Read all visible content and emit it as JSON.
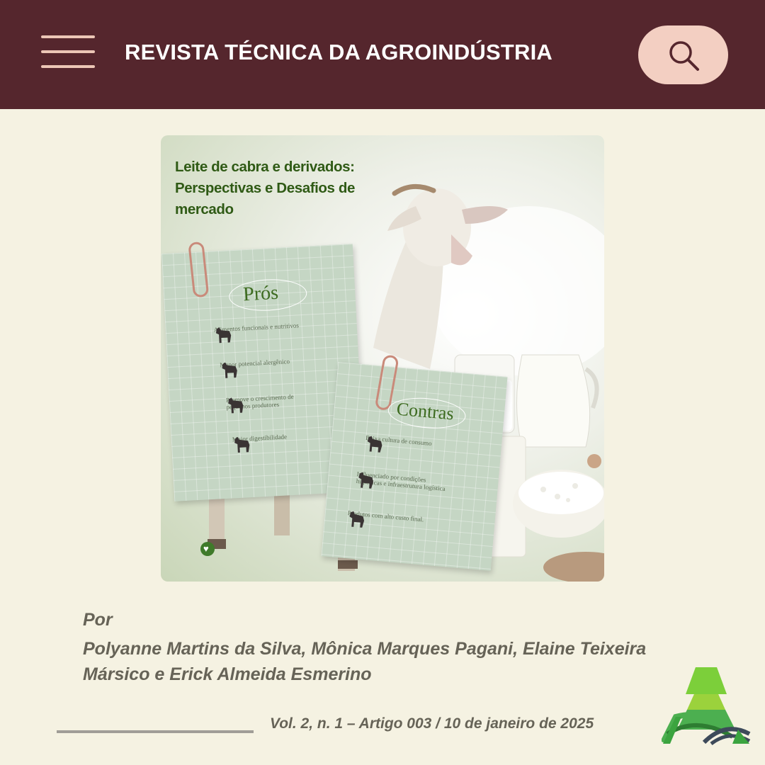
{
  "header": {
    "site_title": "REVISTA TÉCNICA DA AGROINDÚSTRIA",
    "menu_icon": "hamburger-menu-icon",
    "search_icon": "search-icon"
  },
  "hero": {
    "title_line1": "Leite de cabra e derivados:",
    "title_line2": "Perspectivas e Desafios de",
    "title_line3": "mercado",
    "pros": {
      "heading": "Prós",
      "items": [
        "Alimentos funcionais e nutritivos",
        "Menor potencial alergênico",
        "Promove o crescimento de pequenos produtores",
        "Maior digestibilidade"
      ]
    },
    "contras": {
      "heading": "Contras",
      "items": [
        "Baixa cultura de consumo",
        "Influenciado por condições higiênicas e infraestrutura logística",
        "Produtos com alto custo final."
      ]
    }
  },
  "byline": {
    "label": "Por",
    "authors": "Polyanne Martins da Silva, Mônica Marques Pagani, Elaine Teixeira Mársico e Erick Almeida Esmerino"
  },
  "issue": "Vol. 2, n. 1 – Artigo 003 / 10 de janeiro de 2025",
  "colors": {
    "header_bg": "#55262d",
    "page_bg": "#f5f2e2",
    "accent_pink": "#f3cfc2",
    "title_green": "#2f5a15",
    "text_gray": "#666357"
  }
}
